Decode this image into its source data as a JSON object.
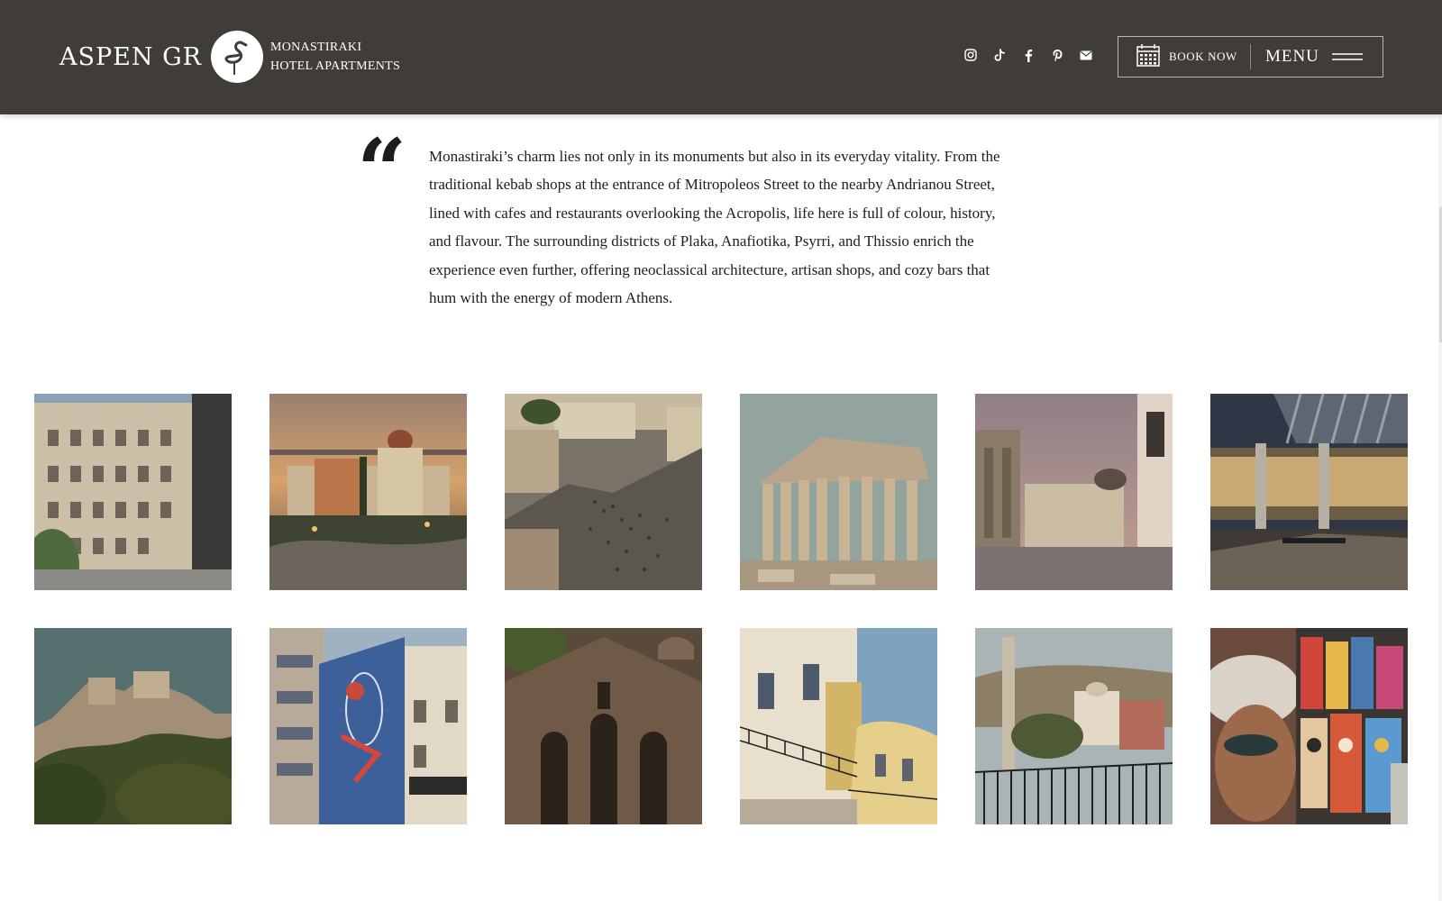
{
  "header": {
    "brand_name": "ASPEN GR",
    "brand_line1": "MONASTIRAKI",
    "brand_line2": "HOTEL APARTMENTS",
    "book_label": "BOOK NOW",
    "menu_label": "MENU",
    "social": [
      "instagram-icon",
      "tiktok-icon",
      "facebook-icon",
      "pinterest-icon",
      "email-icon"
    ]
  },
  "quote": {
    "mark": "“",
    "text": "Monastiraki’s charm lies not only in its monuments but also in its everyday vitality. From the traditional kebab shops at the entrance of Mitropoleos Street to the nearby Andrianou Street, lined with cafes and restaurants overlooking the Acropolis, life here is full of colour, history, and flavour. The surrounding districts of Plaka, Anafiotika, Psyrri, and Thissio enrich the experience even further, offering neoclassical architecture, artisan shops, and cozy bars that hum with the energy of modern Athens."
  },
  "colors": {
    "header_bg": "#403d38",
    "text": "#1e1d1b"
  }
}
